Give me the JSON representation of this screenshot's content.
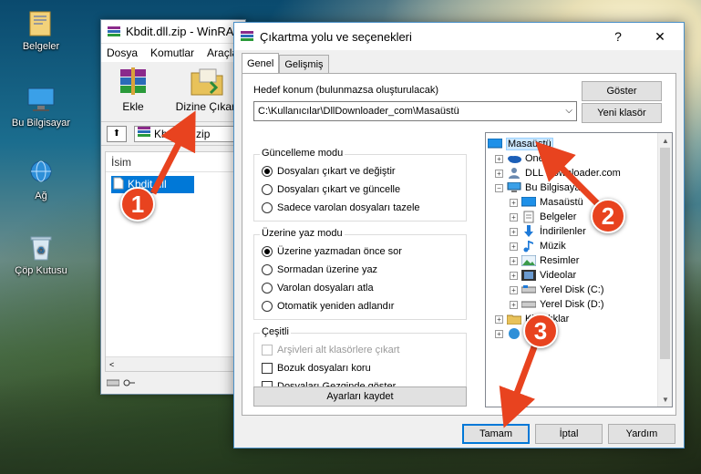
{
  "desktop": {
    "icons": [
      {
        "label": "Belgeler",
        "icon": "folder-documents-icon"
      },
      {
        "label": "Bu Bilgisayar",
        "icon": "computer-icon"
      },
      {
        "label": "Ağ",
        "icon": "network-icon"
      },
      {
        "label": "Çöp Kutusu",
        "icon": "recycle-bin-icon"
      }
    ]
  },
  "winrar": {
    "title": "Kbdit.dll.zip - WinRA",
    "menu": [
      "Dosya",
      "Komutlar",
      "Araçla"
    ],
    "toolbar": {
      "add_label": "Ekle",
      "extract_label": "Dizine Çıkart"
    },
    "path": "Kbdit.dll.zip",
    "column_name": "İsim",
    "selected_file": "Kbdit.dll"
  },
  "dialog": {
    "title": "Çıkartma yolu ve seçenekleri",
    "help_btn": "?",
    "close_btn": "✕",
    "tabs": [
      "Genel",
      "Gelişmiş"
    ],
    "dest_label": "Hedef konum (bulunmazsa oluşturulacak)",
    "dest_value": "C:\\Kullanıcılar\\DllDownloader_com\\Masaüstü",
    "show_btn": "Göster",
    "new_folder_btn": "Yeni klasör",
    "update_mode": {
      "title": "Güncelleme modu",
      "options": [
        "Dosyaları çıkart ve değiştir",
        "Dosyaları çıkart ve güncelle",
        "Sadece varolan dosyaları tazele"
      ],
      "selected": 0
    },
    "overwrite_mode": {
      "title": "Üzerine yaz modu",
      "options": [
        "Üzerine yazmadan önce sor",
        "Sormadan üzerine yaz",
        "Varolan dosyaları atla",
        "Otomatik yeniden adlandır"
      ],
      "selected": 0
    },
    "misc": {
      "title": "Çeşitli",
      "options": [
        "Arşivleri alt klasörlere çıkart",
        "Bozuk dosyaları koru",
        "Dosyaları Gezginde göster"
      ]
    },
    "save_settings_btn": "Ayarları kaydet",
    "tree": [
      {
        "label": "Masaüstü",
        "icon": "desktop-icon",
        "selected": true
      },
      {
        "label": "OneDrive",
        "icon": "onedrive-icon"
      },
      {
        "label": "DLL Downloader.com",
        "icon": "user-icon"
      },
      {
        "label": "Bu Bilgisayar",
        "icon": "computer-icon"
      },
      {
        "label": "Masaüstü",
        "icon": "desktop-icon"
      },
      {
        "label": "Belgeler",
        "icon": "documents-icon"
      },
      {
        "label": "İndirilenler",
        "icon": "downloads-icon"
      },
      {
        "label": "Müzik",
        "icon": "music-icon"
      },
      {
        "label": "Resimler",
        "icon": "pictures-icon"
      },
      {
        "label": "Videolar",
        "icon": "videos-icon"
      },
      {
        "label": "Yerel Disk (C:)",
        "icon": "disk-icon"
      },
      {
        "label": "Yerel Disk (D:)",
        "icon": "disk-icon"
      },
      {
        "label": "Kitaplıklar",
        "icon": "libraries-icon"
      },
      {
        "label": "Ağ",
        "icon": "network-icon"
      }
    ],
    "ok_btn": "Tamam",
    "cancel_btn": "İptal",
    "help_label": "Yardım"
  },
  "annotations": {
    "step1": "1",
    "step2": "2",
    "step3": "3",
    "color": "#e8431f"
  }
}
